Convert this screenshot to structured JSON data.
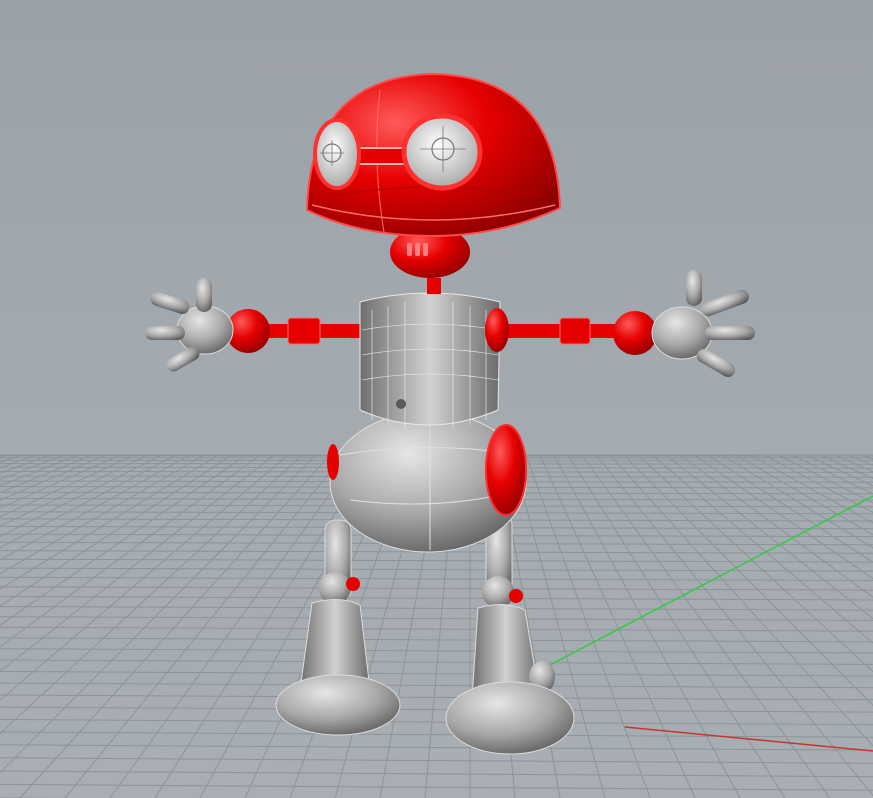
{
  "viewport": {
    "background_color": "#a3aab0",
    "grid_color": "#8d9398",
    "x_axis_color": "#c0392b",
    "y_axis_color": "#2ecc40"
  },
  "model": {
    "highlight_color": "#e60000",
    "body_color": "#9a9a9a"
  }
}
